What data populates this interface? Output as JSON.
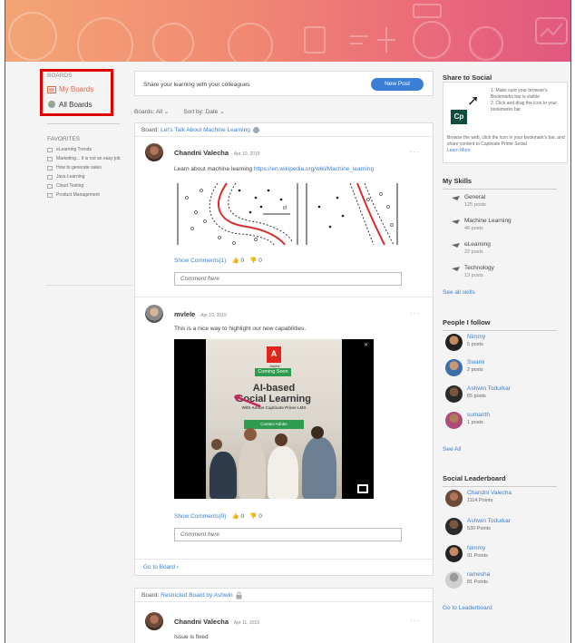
{
  "left": {
    "boards_title": "BOARDS",
    "my_boards": "My Boards",
    "all_boards": "All Boards",
    "favorites_title": "FAVORITES",
    "favorites": [
      "eLearning Trends",
      "Marketing... It is not an easy job",
      "How to generate sales",
      "Java Learning",
      "Cloud Testing",
      "Product Management"
    ]
  },
  "center": {
    "share_text": "Share your learning with your colleagues",
    "new_post": "New Post",
    "filter_boards": "Boards: All ⌄",
    "filter_sort": "Sort by: Date ⌄",
    "card1": {
      "head_prefix": "Board:",
      "head_link": "Let's Talk About Machine Learning",
      "post1": {
        "author": "Chandni Valecha",
        "date": "· Apr 10, 2019",
        "text": "Learn about machine learning",
        "link": "https://en.wikipedia.org/wiki/Machine_learning",
        "show_comments": "Show Comments(1)",
        "likes": "0",
        "dislikes": "0",
        "comment_placeholder": "Comment here"
      },
      "post2": {
        "author": "mvlele",
        "date": "· Apr 10, 2019",
        "text": "This is a nice way to highlight our new capabilities.",
        "ad": {
          "logo": "A",
          "logo_text": "Adobe",
          "coming_soon": "Coming Soon",
          "title_line1": "AI-based",
          "title_line2": "Social Learning",
          "subtitle": "With Adobe Captivate Prime LMS",
          "button": "Contact Adobe",
          "close": "✕"
        },
        "show_comments": "Show Comments(0)",
        "likes": "0",
        "dislikes": "0",
        "comment_placeholder": "Comment here"
      },
      "goto_board": "Go to Board ›"
    },
    "card2": {
      "head_prefix": "Board:",
      "head_link": "Restricted Board by Ashwin",
      "post": {
        "author": "Chandni Valecha",
        "date": "· Apr 11, 2019",
        "text": "Issue is fixed"
      }
    },
    "more": "···"
  },
  "right": {
    "share_social": {
      "title": "Share to Social",
      "step1": "1.  Make sure your browser's Bookmarks bar is visible",
      "step2": "2.  Click and drag the icon to your bookmarks bar",
      "desc": "Browse the web, click the icon in your bookmark's bar, and share content to Captivate Prime Social",
      "learn_more": "Learn More",
      "logo": "Cp"
    },
    "my_skills": {
      "title": "My Skills",
      "items": [
        {
          "name": "General",
          "posts": "125 posts"
        },
        {
          "name": "Machine Learning",
          "posts": "46 posts"
        },
        {
          "name": "eLearning",
          "posts": "22 posts"
        },
        {
          "name": "Technology",
          "posts": "13 posts"
        }
      ],
      "see_all": "See all skills"
    },
    "people_follow": {
      "title": "People I follow",
      "items": [
        {
          "name": "Nimmy",
          "sub": "5 posts"
        },
        {
          "name": "Swami",
          "sub": "2 posts"
        },
        {
          "name": "Ashwin Todurkar",
          "sub": "65 posts"
        },
        {
          "name": "sumanth",
          "sub": "1 posts"
        }
      ],
      "see_all": "See All"
    },
    "leaderboard": {
      "title": "Social Leaderboard",
      "items": [
        {
          "name": "Chandni Valecha",
          "sub": "1114 Points"
        },
        {
          "name": "Ashwin Todurkar",
          "sub": "530 Points"
        },
        {
          "name": "Nimmy",
          "sub": "91 Points"
        },
        {
          "name": "ramesha",
          "sub": "81 Points"
        }
      ],
      "goto": "Go to Leaderboard"
    }
  },
  "colors": {
    "accent": "#3a7fd5",
    "highlight_box": "#e00000",
    "brand_orange": "#e06a4a"
  }
}
